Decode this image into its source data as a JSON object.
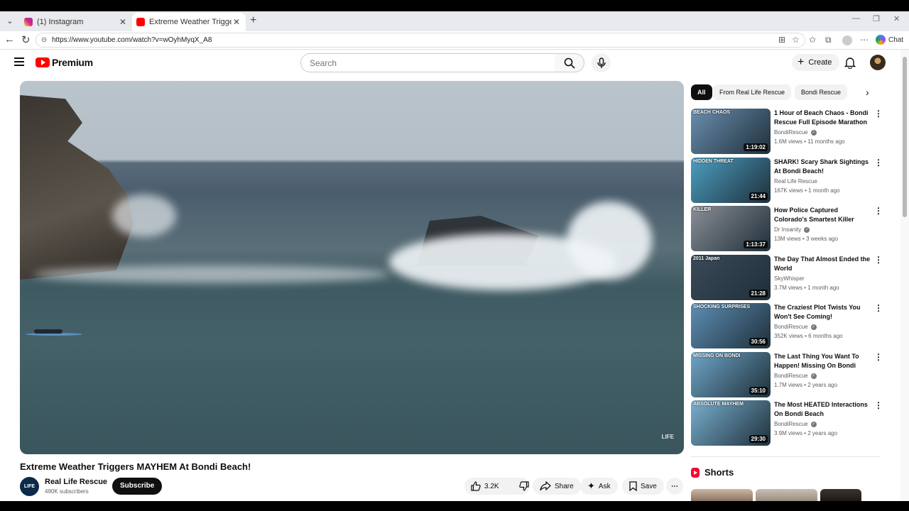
{
  "browser": {
    "tabs": [
      {
        "title": "(1) Instagram",
        "favicon_color": "#d6249f"
      },
      {
        "title": "Extreme Weather Triggers MAYHEM",
        "favicon_color": "#ff0000"
      }
    ],
    "url": "https://www.youtube.com/watch?v=wOyhMyqX_A8",
    "chat_label": "Chat"
  },
  "header": {
    "logo_text": "Premium",
    "search_placeholder": "Search",
    "create_label": "Create"
  },
  "video": {
    "title": "Extreme Weather Triggers MAYHEM At Bondi Beach!",
    "watermark": "LIFE",
    "channel": {
      "name": "Real Life Rescue",
      "subscribers": "490K subscribers",
      "avatar_text": "LIFE"
    },
    "subscribe_label": "Subscribe",
    "likes": "3.2K",
    "share_label": "Share",
    "ask_label": "Ask",
    "save_label": "Save"
  },
  "sidebar": {
    "chips": [
      "All",
      "From Real Life Rescue",
      "Bondi Rescue"
    ],
    "recommendations": [
      {
        "title": "1 Hour of Beach Chaos - Bondi Rescue Full Episode Marathon",
        "channel": "BondiRescue",
        "verified": true,
        "meta": "1.6M views • 11 months ago",
        "duration": "1:19:02",
        "thumb_label": "BEACH CHAOS",
        "thumb_color": "#6a8fb0"
      },
      {
        "title": "SHARK! Scary Shark Sightings At Bondi Beach!",
        "channel": "Real Life Rescue",
        "verified": false,
        "meta": "167K views • 1 month ago",
        "duration": "21:44",
        "thumb_label": "HIDDEN THREAT",
        "thumb_color": "#4b9fc2"
      },
      {
        "title": "How Police Captured Colorado's Smartest Killer",
        "channel": "Dr Insanity",
        "verified": true,
        "meta": "13M views • 3 weeks ago",
        "duration": "1:13:37",
        "thumb_label": "KILLER",
        "thumb_color": "#8a8f96"
      },
      {
        "title": "The Day That Almost Ended the World",
        "channel": "SkyWhisper",
        "verified": false,
        "meta": "3.7M views • 1 month ago",
        "duration": "21:28",
        "thumb_label": "2011 Japan",
        "thumb_color": "#3a4a58"
      },
      {
        "title": "The Craziest Plot Twists You Won't See Coming!",
        "channel": "BondiRescue",
        "verified": true,
        "meta": "352K views • 6 months ago",
        "duration": "30:56",
        "thumb_label": "SHOCKING SURPRISES",
        "thumb_color": "#5d8fb5"
      },
      {
        "title": "The Last Thing You Want To Happen! Missing On Bondi",
        "channel": "BondiRescue",
        "verified": true,
        "meta": "1.7M views • 2 years ago",
        "duration": "35:10",
        "thumb_label": "MISSING ON BONDI",
        "thumb_color": "#6fa6c8"
      },
      {
        "title": "The Most HEATED Interactions On Bondi Beach",
        "channel": "BondiRescue",
        "verified": true,
        "meta": "3.9M views • 2 years ago",
        "duration": "29:30",
        "thumb_label": "ABSOLUTE MAYHEM",
        "thumb_color": "#79b0cf"
      }
    ],
    "shorts_heading": "Shorts"
  }
}
